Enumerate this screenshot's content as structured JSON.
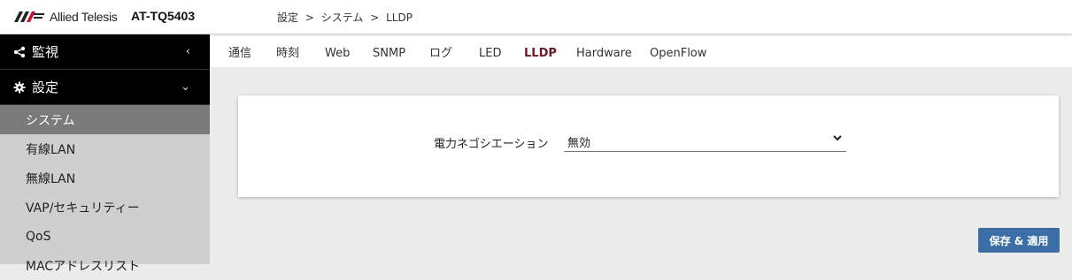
{
  "header": {
    "brand": "Allied Telesis",
    "product": "AT-TQ5403",
    "breadcrumb": [
      "設定",
      ">",
      "システム",
      ">",
      "LLDP"
    ]
  },
  "sidebar": {
    "groups": [
      {
        "label": "監視",
        "icon": "share-icon",
        "chevron": "‹"
      },
      {
        "label": "設定",
        "icon": "gear-icon",
        "chevron": "⌄"
      }
    ],
    "items": [
      {
        "label": "システム",
        "active": true
      },
      {
        "label": "有線LAN"
      },
      {
        "label": "無線LAN"
      },
      {
        "label": "VAP/セキュリティー"
      },
      {
        "label": "QoS"
      },
      {
        "label": "MACアドレスリスト"
      }
    ]
  },
  "tabs": [
    "通信",
    "時刻",
    "Web",
    "SNMP",
    "ログ",
    "LED",
    "LLDP",
    "Hardware",
    "OpenFlow"
  ],
  "active_tab": "LLDP",
  "form": {
    "power_negotiation_label": "電力ネゴシエーション",
    "power_negotiation_value": "無効"
  },
  "actions": {
    "save_label": "保存 & 適用"
  },
  "colors": {
    "accent": "#6b1a2a",
    "button": "#3a6ea5",
    "sidebar_active": "#7a7a7a",
    "sidebar_header": "#000000"
  }
}
